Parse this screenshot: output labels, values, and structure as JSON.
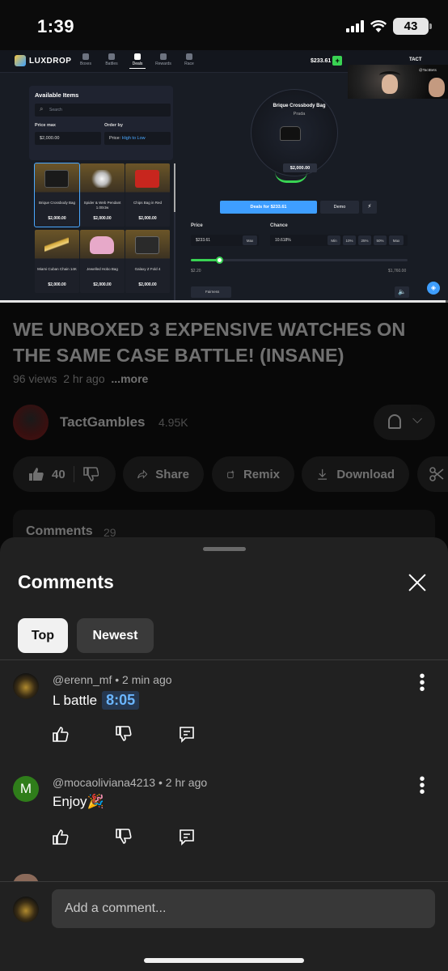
{
  "status_bar": {
    "time": "1:39",
    "battery": "43"
  },
  "site": {
    "brand": "LUXDROP",
    "nav": [
      "Boxes",
      "Battles",
      "Deals",
      "Rewards",
      "Race"
    ],
    "balance": "$233.61",
    "user": "TACT",
    "cam_tag": "@TactBets",
    "available_items": {
      "title": "Available Items",
      "search_placeholder": "Search",
      "price_max_label": "Price max",
      "price_max_value": "$2,000.00",
      "order_by_label": "Order by",
      "order_by_prefix": "Price:",
      "order_by_value": "High to Low"
    },
    "items": [
      {
        "name": "Brique Crossbody Bag",
        "price": "$2,000.00",
        "color": "#1a1a1a"
      },
      {
        "name": "Spider & Web Pendant 1.00ctw",
        "price": "$2,000.00",
        "color": "#e0e0e0"
      },
      {
        "name": "Chips Bag in Red",
        "price": "$2,000.00",
        "color": "#c8261e"
      },
      {
        "name": "Miami Cuban Chain 14K",
        "price": "$2,000.00",
        "color": "#d4a83a"
      },
      {
        "name": "Jewelled Hobo Bag",
        "price": "$2,000.00",
        "color": "#e7a9c9"
      },
      {
        "name": "Galaxy Z Fold 4",
        "price": "$2,000.00",
        "color": "#2a2a2a"
      }
    ],
    "deal": {
      "item": "Brique Crossbody Bag",
      "brand": "Prada",
      "price": "$2,000.00",
      "deals_button": "Deals for $233.61",
      "demo_button": "Demo",
      "price_label": "Price",
      "price_value": "$233.61",
      "max_label": "Max",
      "chance_label": "Chance",
      "chance_value": "10.618%",
      "chance_buttons": [
        "Min",
        "10%",
        "25%",
        "50%",
        "Max"
      ],
      "range_min": "$2.20",
      "range_max": "$1,760.00",
      "range_level": 0.13,
      "fairness": "Fairness"
    },
    "playback_progress": 0.995
  },
  "video": {
    "title": "WE UNBOXED 3 EXPENSIVE WATCHES ON THE SAME CASE BATTLE! (INSANE)",
    "views": "96 views",
    "age": "2 hr ago",
    "more": "...more",
    "channel": "TactGambles",
    "subscribers": "4.95K",
    "likes": "40",
    "share": "Share",
    "remix": "Remix",
    "download": "Download",
    "comments_label": "Comments",
    "comments_count": "29"
  },
  "comments_sheet": {
    "title": "Comments",
    "tabs": [
      "Top",
      "Newest"
    ],
    "comments": [
      {
        "author": "@erenn_mf",
        "time": "2 min ago",
        "text": "L battle",
        "timestamp": "8:05"
      },
      {
        "author": "@mocaoliviana4213",
        "time": "2 hr ago",
        "text": "Enjoy🎉",
        "avatar_letter": "M"
      }
    ],
    "composer_placeholder": "Add a comment..."
  },
  "icons": [
    "signal-icon",
    "wifi-icon",
    "battery-icon",
    "bell-icon",
    "like-icon",
    "dislike-icon",
    "share-icon",
    "remix-icon",
    "download-icon",
    "scissors-icon",
    "close-icon",
    "more-icon",
    "reply-icon"
  ]
}
